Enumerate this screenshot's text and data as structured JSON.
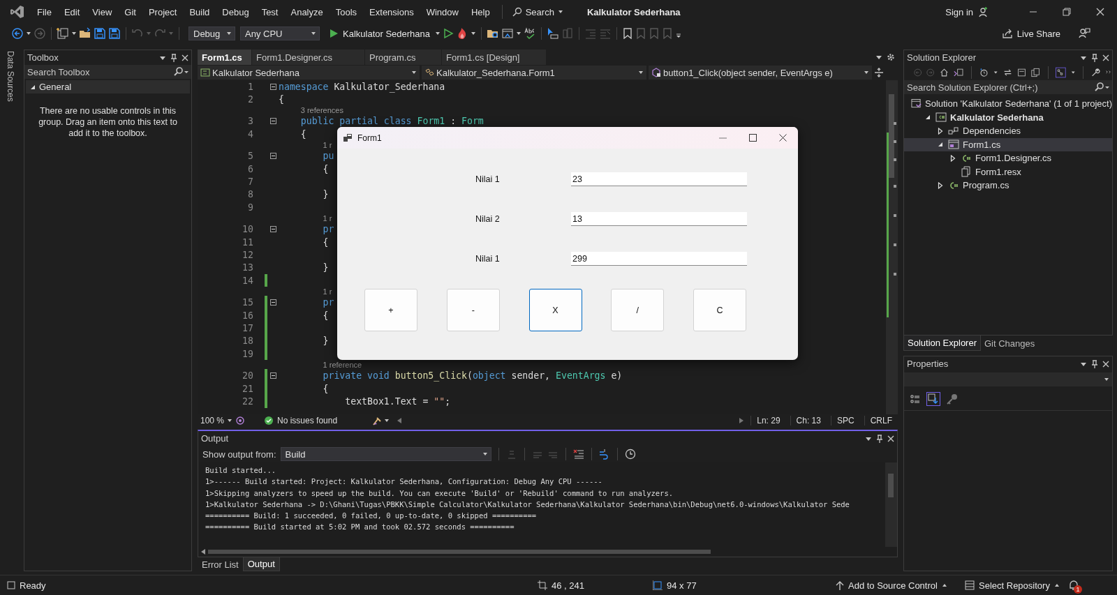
{
  "menu_bar": {
    "items": [
      "File",
      "Edit",
      "View",
      "Git",
      "Project",
      "Build",
      "Debug",
      "Test",
      "Analyze",
      "Tools",
      "Extensions",
      "Window",
      "Help"
    ],
    "search": "Search",
    "title": "Kalkulator Sederhana",
    "sign_in": "Sign in"
  },
  "toolbar": {
    "configuration": "Debug",
    "platform": "Any CPU",
    "start_target": "Kalkulator Sederhana",
    "live_share": "Live Share"
  },
  "side_strip": {
    "label": "Data Sources"
  },
  "toolbox": {
    "title": "Toolbox",
    "search": {
      "placeholder": "Search Toolbox"
    },
    "group": {
      "label": "General",
      "expanded": true
    },
    "message": "There are no usable controls in this group. Drag an item onto this text to add it to the toolbox."
  },
  "editor": {
    "tabs": [
      {
        "label": "Form1.cs",
        "selected": true
      },
      {
        "label": "Form1.Designer.cs",
        "selected": false
      },
      {
        "label": "Program.cs",
        "selected": false
      },
      {
        "label": "Form1.cs [Design]",
        "selected": false
      }
    ],
    "navigation": [
      "Kalkulator Sederhana",
      "Kalkulator_Sederhana.Form1",
      "button1_Click(object sender, EventArgs e)"
    ],
    "lines": [
      {
        "kind": "code",
        "number": "1",
        "foldable": true,
        "changed": false,
        "tokens": [
          {
            "text": "namespace",
            "kind": "keyword"
          },
          {
            "text": " Kalkulator_Sederhana",
            "kind": "plain"
          }
        ]
      },
      {
        "kind": "code",
        "number": "2",
        "foldable": false,
        "changed": false,
        "tokens": [
          {
            "text": "{",
            "kind": "plain"
          }
        ]
      },
      {
        "kind": "lens",
        "text": "3 references"
      },
      {
        "kind": "code",
        "number": "3",
        "foldable": true,
        "changed": false,
        "tokens": [
          {
            "text": "    public partial class",
            "kind": "keyword"
          },
          {
            "text": " Form1",
            "kind": "type"
          },
          {
            "text": " : ",
            "kind": "plain"
          },
          {
            "text": "Form",
            "kind": "type"
          }
        ]
      },
      {
        "kind": "code",
        "number": "4",
        "foldable": false,
        "changed": false,
        "tokens": [
          {
            "text": "    {",
            "kind": "plain"
          }
        ]
      },
      {
        "kind": "lens",
        "text": "1 r"
      },
      {
        "kind": "code",
        "number": "5",
        "foldable": true,
        "changed": false,
        "tokens": [
          {
            "text": "        pu",
            "kind": "keyword"
          }
        ]
      },
      {
        "kind": "code",
        "number": "6",
        "foldable": false,
        "changed": false,
        "tokens": [
          {
            "text": "        {",
            "kind": "plain"
          }
        ]
      },
      {
        "kind": "code",
        "number": "7",
        "foldable": false,
        "changed": false
      },
      {
        "kind": "code",
        "number": "8",
        "foldable": false,
        "changed": false,
        "tokens": [
          {
            "text": "        }",
            "kind": "plain"
          }
        ]
      },
      {
        "kind": "code",
        "number": "9",
        "foldable": false,
        "changed": false
      },
      {
        "kind": "lens",
        "text": "1 r"
      },
      {
        "kind": "code",
        "number": "10",
        "foldable": true,
        "changed": false,
        "tokens": [
          {
            "text": "        pr",
            "kind": "keyword"
          }
        ]
      },
      {
        "kind": "code",
        "number": "11",
        "foldable": false,
        "changed": false,
        "tokens": [
          {
            "text": "        {",
            "kind": "plain"
          }
        ]
      },
      {
        "kind": "code",
        "number": "12",
        "foldable": false,
        "changed": false
      },
      {
        "kind": "code",
        "number": "13",
        "foldable": false,
        "changed": false,
        "tokens": [
          {
            "text": "        }",
            "kind": "plain"
          }
        ]
      },
      {
        "kind": "code",
        "number": "14",
        "foldable": false,
        "changed": true
      },
      {
        "kind": "lens",
        "text": "1 r"
      },
      {
        "kind": "code",
        "number": "15",
        "foldable": true,
        "changed": true,
        "tokens": [
          {
            "text": "        pr",
            "kind": "keyword"
          }
        ]
      },
      {
        "kind": "code",
        "number": "16",
        "foldable": false,
        "changed": true,
        "tokens": [
          {
            "text": "        {",
            "kind": "plain"
          }
        ]
      },
      {
        "kind": "code",
        "number": "17",
        "foldable": false,
        "changed": true
      },
      {
        "kind": "code",
        "number": "18",
        "foldable": false,
        "changed": true,
        "tokens": [
          {
            "text": "        }",
            "kind": "plain"
          }
        ]
      },
      {
        "kind": "code",
        "number": "19",
        "foldable": false,
        "changed": true
      },
      {
        "kind": "lens",
        "text": "1 reference"
      },
      {
        "kind": "code",
        "number": "20",
        "foldable": true,
        "changed": true,
        "tokens": [
          {
            "text": "        private void",
            "kind": "keyword"
          },
          {
            "text": " button5_Click",
            "kind": "method"
          },
          {
            "text": "(",
            "kind": "plain"
          },
          {
            "text": "object",
            "kind": "keyword"
          },
          {
            "text": " sender, ",
            "kind": "plain"
          },
          {
            "text": "EventArgs",
            "kind": "type"
          },
          {
            "text": " e)",
            "kind": "plain"
          }
        ]
      },
      {
        "kind": "code",
        "number": "21",
        "foldable": false,
        "changed": true,
        "tokens": [
          {
            "text": "        {",
            "kind": "plain"
          }
        ]
      },
      {
        "kind": "code",
        "number": "22",
        "foldable": false,
        "changed": true,
        "tokens": [
          {
            "text": "            textBox1.Text = ",
            "kind": "plain"
          },
          {
            "text": "\"\"",
            "kind": "string"
          },
          {
            "text": ";",
            "kind": "plain"
          }
        ]
      }
    ],
    "status": {
      "zoom": "100 %",
      "issues": "No issues found",
      "line": "Ln: 29",
      "column": "Ch: 13",
      "indent": "SPC",
      "line_ending": "CRLF"
    }
  },
  "form_window": {
    "title": "Form1",
    "fields": [
      {
        "label": "Nilai 1",
        "value": "23"
      },
      {
        "label": "Nilai 2",
        "value": "13"
      },
      {
        "label": "Nilai 1",
        "value": "299"
      }
    ],
    "buttons": [
      {
        "label": "+",
        "focused": false
      },
      {
        "label": "-",
        "focused": false
      },
      {
        "label": "X",
        "focused": true
      },
      {
        "label": "/",
        "focused": false
      },
      {
        "label": "C",
        "focused": false
      }
    ]
  },
  "output": {
    "title": "Output",
    "source_label": "Show output from:",
    "source": "Build",
    "lines": [
      "Build started...",
      "1>------ Build started: Project: Kalkulator Sederhana, Configuration: Debug Any CPU ------",
      "1>Skipping analyzers to speed up the build. You can execute 'Build' or 'Rebuild' command to run analyzers.",
      "1>Kalkulator Sederhana -> D:\\Ghani\\Tugas\\PBKK\\Simple Calculator\\Kalkulator Sederhana\\Kalkulator Sederhana\\bin\\Debug\\net6.0-windows\\Kalkulator Sede",
      "========== Build: 1 succeeded, 0 failed, 0 up-to-date, 0 skipped ==========",
      "========== Build started at 5:02 PM and took 02.572 seconds =========="
    ]
  },
  "bottom_tabs": [
    {
      "label": "Error List",
      "selected": false
    },
    {
      "label": "Output",
      "selected": true
    }
  ],
  "solution_explorer": {
    "title": "Solution Explorer",
    "search": {
      "placeholder": "Search Solution Explorer (Ctrl+;)"
    },
    "tree": [
      {
        "label": "Solution 'Kalkulator Sederhana' (1 of 1 project)",
        "kind": "solution",
        "selected": false,
        "children": [
          {
            "label": "Kalkulator Sederhana",
            "kind": "project",
            "expanded": true,
            "selected": false,
            "children": [
              {
                "label": "Dependencies",
                "kind": "dependencies",
                "expanded": false,
                "selected": false
              },
              {
                "label": "Form1.cs",
                "kind": "form",
                "expanded": true,
                "selected": true,
                "children": [
                  {
                    "label": "Form1.Designer.cs",
                    "kind": "csharp",
                    "expanded": false,
                    "selected": false
                  },
                  {
                    "label": "Form1.resx",
                    "kind": "resource",
                    "selected": false
                  }
                ]
              },
              {
                "label": "Program.cs",
                "kind": "csharp",
                "expanded": false,
                "selected": false
              }
            ]
          }
        ]
      }
    ],
    "tabs": [
      {
        "label": "Solution Explorer",
        "selected": true
      },
      {
        "label": "Git Changes",
        "selected": false
      }
    ]
  },
  "properties": {
    "title": "Properties"
  },
  "status_bar": {
    "state": "Ready",
    "position": "46 , 241",
    "size": "94 x 77",
    "source_control": "Add to Source Control",
    "repository": "Select Repository",
    "notifications": "1"
  }
}
